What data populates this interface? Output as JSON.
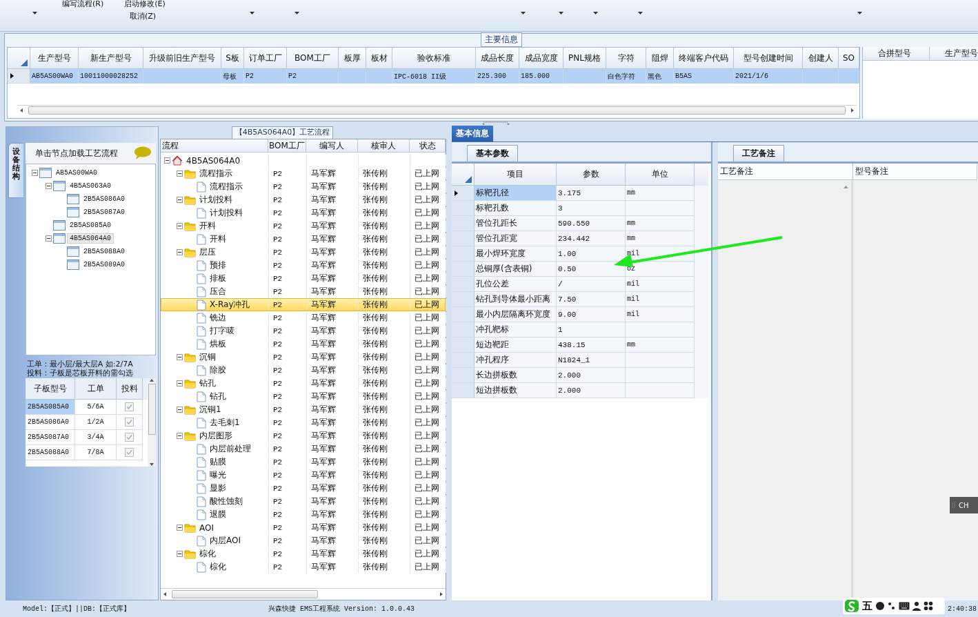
{
  "toolbar": {
    "items": [
      {
        "label": "编写流程(R)"
      },
      {
        "label": "启动修改(E)"
      },
      {
        "label": "取消(Z)"
      }
    ]
  },
  "main_info": {
    "title": "主要信息",
    "columns": [
      "生产型号",
      "新生产型号",
      "升级前旧生产型号",
      "S板",
      "订单工厂",
      "BOM工厂",
      "板厚",
      "板材",
      "验收标准",
      "成品长度",
      "成品宽度",
      "PNL规格",
      "字符",
      "阻焊",
      "终端客户代码",
      "型号创建时间",
      "创建人",
      "SO"
    ],
    "rows": [
      {
        "selected": true,
        "cells": [
          "AB5AS00WA0",
          "10011000028252",
          "",
          "母板",
          "P2",
          "P2",
          "",
          "",
          "IPC-6018 II级",
          "225.300",
          "185.000",
          "",
          "白色字符",
          "黑色",
          "B5AS",
          "2021/1/6",
          "",
          ""
        ]
      }
    ],
    "side_columns": [
      "合拼型号",
      "生产型号"
    ]
  },
  "structure_panel": {
    "tab": "设备结构",
    "hint": "单击节点加载工艺流程",
    "tree": [
      {
        "label": "AB5AS00WA0",
        "expanded": true,
        "selected": false,
        "children": [
          {
            "label": "4B5AS063A0",
            "expanded": true,
            "selected": false,
            "children": [
              {
                "label": "2B5AS086A0",
                "selected": false
              },
              {
                "label": "2B5AS087A0",
                "selected": false
              }
            ]
          },
          {
            "label": "2B5AS085A0",
            "selected": false
          },
          {
            "label": "4B5AS064A0",
            "expanded": true,
            "selected": true,
            "children": [
              {
                "label": "2B5AS088A0",
                "selected": false
              },
              {
                "label": "2B5AS089A0",
                "selected": false
              }
            ]
          }
        ]
      }
    ],
    "notes": [
      "工单：最小层/最大层A 如:2/7A",
      "投料：子板是芯板开料的需勾选"
    ],
    "sub_table": {
      "columns": [
        "子板型号",
        "工单",
        "投料"
      ],
      "rows": [
        {
          "model": "2B5AS085A0",
          "order": "5/6A",
          "feed": true,
          "selected": true
        },
        {
          "model": "2B5AS086A0",
          "order": "1/2A",
          "feed": true,
          "selected": false
        },
        {
          "model": "2B5AS087A0",
          "order": "3/4A",
          "feed": true,
          "selected": false
        },
        {
          "model": "2B5AS088A0",
          "order": "7/8A",
          "feed": true,
          "selected": false
        }
      ]
    }
  },
  "flow_panel": {
    "title": "【4B5AS064A0】工艺流程",
    "columns": [
      "流程",
      "BOM工厂",
      "编写人",
      "核审人",
      "状态"
    ],
    "tree": [
      {
        "label": "4B5AS064A0",
        "kind": "root",
        "expanded": true,
        "selected": false,
        "children": [
          {
            "label": "流程指示",
            "kind": "folder",
            "expanded": true,
            "selected": false,
            "bom": "P2",
            "writer": "马军辉",
            "reviewer": "张传刚",
            "status": "已上网",
            "children": [
              {
                "label": "流程指示",
                "kind": "step",
                "selected": false,
                "bom": "P2",
                "writer": "马军辉",
                "reviewer": "张传刚",
                "status": "已上网"
              }
            ]
          },
          {
            "label": "计划投料",
            "kind": "folder",
            "expanded": true,
            "selected": false,
            "bom": "P2",
            "writer": "马军辉",
            "reviewer": "张传刚",
            "status": "已上网",
            "children": [
              {
                "label": "计划投料",
                "kind": "step",
                "selected": false,
                "bom": "P2",
                "writer": "马军辉",
                "reviewer": "张传刚",
                "status": "已上网"
              }
            ]
          },
          {
            "label": "开料",
            "kind": "folder",
            "expanded": true,
            "selected": false,
            "bom": "P2",
            "writer": "马军辉",
            "reviewer": "张传刚",
            "status": "已上网",
            "children": [
              {
                "label": "开料",
                "kind": "step",
                "selected": false,
                "bom": "P2",
                "writer": "马军辉",
                "reviewer": "张传刚",
                "status": "已上网"
              }
            ]
          },
          {
            "label": "层压",
            "kind": "folder",
            "expanded": true,
            "selected": false,
            "bom": "P2",
            "writer": "马军辉",
            "reviewer": "张传刚",
            "status": "已上网",
            "children": [
              {
                "label": "预排",
                "kind": "step",
                "selected": false,
                "bom": "P2",
                "writer": "马军辉",
                "reviewer": "张传刚",
                "status": "已上网"
              },
              {
                "label": "排板",
                "kind": "step",
                "selected": false,
                "bom": "P2",
                "writer": "马军辉",
                "reviewer": "张传刚",
                "status": "已上网"
              },
              {
                "label": "压合",
                "kind": "step",
                "selected": false,
                "bom": "P2",
                "writer": "马军辉",
                "reviewer": "张传刚",
                "status": "已上网"
              },
              {
                "label": "X-Ray冲孔",
                "kind": "step",
                "selected": true,
                "bom": "P2",
                "writer": "马军辉",
                "reviewer": "张传刚",
                "status": "已上网"
              },
              {
                "label": "铣边",
                "kind": "step",
                "selected": false,
                "bom": "P2",
                "writer": "马军辉",
                "reviewer": "张传刚",
                "status": "已上网"
              },
              {
                "label": "打字唛",
                "kind": "step",
                "selected": false,
                "bom": "P2",
                "writer": "马军辉",
                "reviewer": "张传刚",
                "status": "已上网"
              },
              {
                "label": "烘板",
                "kind": "step",
                "selected": false,
                "bom": "P2",
                "writer": "马军辉",
                "reviewer": "张传刚",
                "status": "已上网"
              }
            ]
          },
          {
            "label": "沉铜",
            "kind": "folder",
            "expanded": true,
            "selected": false,
            "bom": "P2",
            "writer": "马军辉",
            "reviewer": "张传刚",
            "status": "已上网",
            "children": [
              {
                "label": "除胶",
                "kind": "step",
                "selected": false,
                "bom": "P2",
                "writer": "马军辉",
                "reviewer": "张传刚",
                "status": "已上网"
              }
            ]
          },
          {
            "label": "钻孔",
            "kind": "folder",
            "expanded": true,
            "selected": false,
            "bom": "P2",
            "writer": "马军辉",
            "reviewer": "张传刚",
            "status": "已上网",
            "children": [
              {
                "label": "钻孔",
                "kind": "step",
                "selected": false,
                "bom": "P2",
                "writer": "马军辉",
                "reviewer": "张传刚",
                "status": "已上网"
              }
            ]
          },
          {
            "label": "沉铜1",
            "kind": "folder",
            "expanded": true,
            "selected": false,
            "bom": "P2",
            "writer": "马军辉",
            "reviewer": "张传刚",
            "status": "已上网",
            "children": [
              {
                "label": "去毛刺1",
                "kind": "step",
                "selected": false,
                "bom": "P2",
                "writer": "马军辉",
                "reviewer": "张传刚",
                "status": "已上网"
              }
            ]
          },
          {
            "label": "内层图形",
            "kind": "folder",
            "expanded": true,
            "selected": false,
            "bom": "P2",
            "writer": "马军辉",
            "reviewer": "张传刚",
            "status": "已上网",
            "children": [
              {
                "label": "内层前处理",
                "kind": "step",
                "selected": false,
                "bom": "P2",
                "writer": "马军辉",
                "reviewer": "张传刚",
                "status": "已上网"
              },
              {
                "label": "贴膜",
                "kind": "step",
                "selected": false,
                "bom": "P2",
                "writer": "马军辉",
                "reviewer": "张传刚",
                "status": "已上网"
              },
              {
                "label": "曝光",
                "kind": "step",
                "selected": false,
                "bom": "P2",
                "writer": "马军辉",
                "reviewer": "张传刚",
                "status": "已上网"
              },
              {
                "label": "显影",
                "kind": "step",
                "selected": false,
                "bom": "P2",
                "writer": "马军辉",
                "reviewer": "张传刚",
                "status": "已上网"
              },
              {
                "label": "酸性蚀刻",
                "kind": "step",
                "selected": false,
                "bom": "P2",
                "writer": "马军辉",
                "reviewer": "张传刚",
                "status": "已上网"
              },
              {
                "label": "退膜",
                "kind": "step",
                "selected": false,
                "bom": "P2",
                "writer": "马军辉",
                "reviewer": "张传刚",
                "status": "已上网"
              }
            ]
          },
          {
            "label": "AOI",
            "kind": "folder",
            "expanded": true,
            "selected": false,
            "bom": "P2",
            "writer": "马军辉",
            "reviewer": "张传刚",
            "status": "已上网",
            "children": [
              {
                "label": "内层AOI",
                "kind": "step",
                "selected": false,
                "bom": "P2",
                "writer": "马军辉",
                "reviewer": "张传刚",
                "status": "已上网"
              }
            ]
          },
          {
            "label": "棕化",
            "kind": "folder",
            "expanded": true,
            "selected": false,
            "bom": "P2",
            "writer": "马军辉",
            "reviewer": "张传刚",
            "status": "已上网",
            "children": [
              {
                "label": "棕化",
                "kind": "step",
                "selected": false,
                "bom": "P2",
                "writer": "马军辉",
                "reviewer": "张传刚",
                "status": "已上网"
              }
            ]
          }
        ]
      }
    ]
  },
  "detail_panel": {
    "tab": "基本信息",
    "params_tab": "基本参数",
    "columns": [
      "项目",
      "参数",
      "单位"
    ],
    "rows": [
      {
        "item": "标靶孔径",
        "value": "3.175",
        "unit": "mm",
        "selected": true
      },
      {
        "item": "标靶孔数",
        "value": "3",
        "unit": "",
        "selected": false
      },
      {
        "item": "管位孔距长",
        "value": "590.550",
        "unit": "mm",
        "selected": false
      },
      {
        "item": "管位孔距宽",
        "value": "234.442",
        "unit": "mm",
        "selected": false
      },
      {
        "item": "最小焊环宽度",
        "value": "1.00",
        "unit": "mil",
        "selected": false
      },
      {
        "item": "总铜厚(含表铜)",
        "value": "0.50",
        "unit": "oz",
        "selected": false
      },
      {
        "item": "孔位公差",
        "value": "/",
        "unit": "mil",
        "selected": false
      },
      {
        "item": "钻孔到导体最小距离",
        "value": "7.50",
        "unit": "mil",
        "selected": false
      },
      {
        "item": "最小内层隔离环宽度",
        "value": "9.00",
        "unit": "mil",
        "selected": false
      },
      {
        "item": "冲孔靶标",
        "value": "1",
        "unit": "",
        "selected": false
      },
      {
        "item": "短边靶距",
        "value": "438.15",
        "unit": "mm",
        "selected": false
      },
      {
        "item": "冲孔程序",
        "value": "N1824_1",
        "unit": "",
        "selected": false
      },
      {
        "item": "长边拼板数",
        "value": "2.000",
        "unit": "",
        "selected": false
      },
      {
        "item": "短边拼板数",
        "value": "2.000",
        "unit": "",
        "selected": false
      }
    ],
    "notes_tab": "工艺备注",
    "notes_columns": [
      "工艺备注",
      "型号备注"
    ]
  },
  "ime": {
    "badge": "CH",
    "mode": "五"
  },
  "status_bar": {
    "left": "Model:【正式】||DB:【正式库】",
    "center": "兴森快捷 EMS工程系统 Version: 1.0.0.43",
    "time": "2:40:38"
  }
}
